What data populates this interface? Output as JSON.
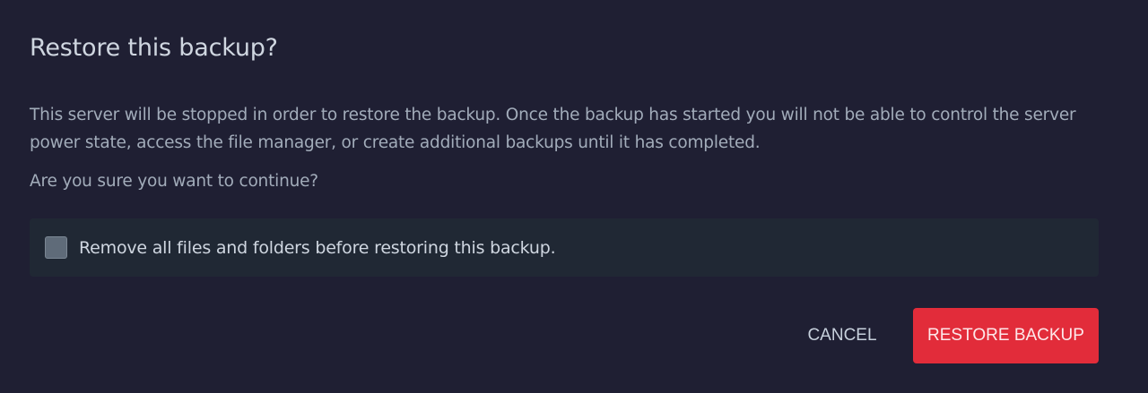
{
  "dialog": {
    "title": "Restore this backup?",
    "description": "This server will be stopped in order to restore the backup. Once the backup has started you will not be able to control the server power state, access the file manager, or create additional backups until it has completed.",
    "confirm_text": "Are you sure you want to continue?",
    "option": {
      "label": "Remove all files and folders before restoring this backup.",
      "checked": false
    },
    "cancel_label": "CANCEL",
    "restore_label": "RESTORE BACKUP",
    "colors": {
      "background": "#1f1f33",
      "danger": "#e22c3a"
    }
  }
}
